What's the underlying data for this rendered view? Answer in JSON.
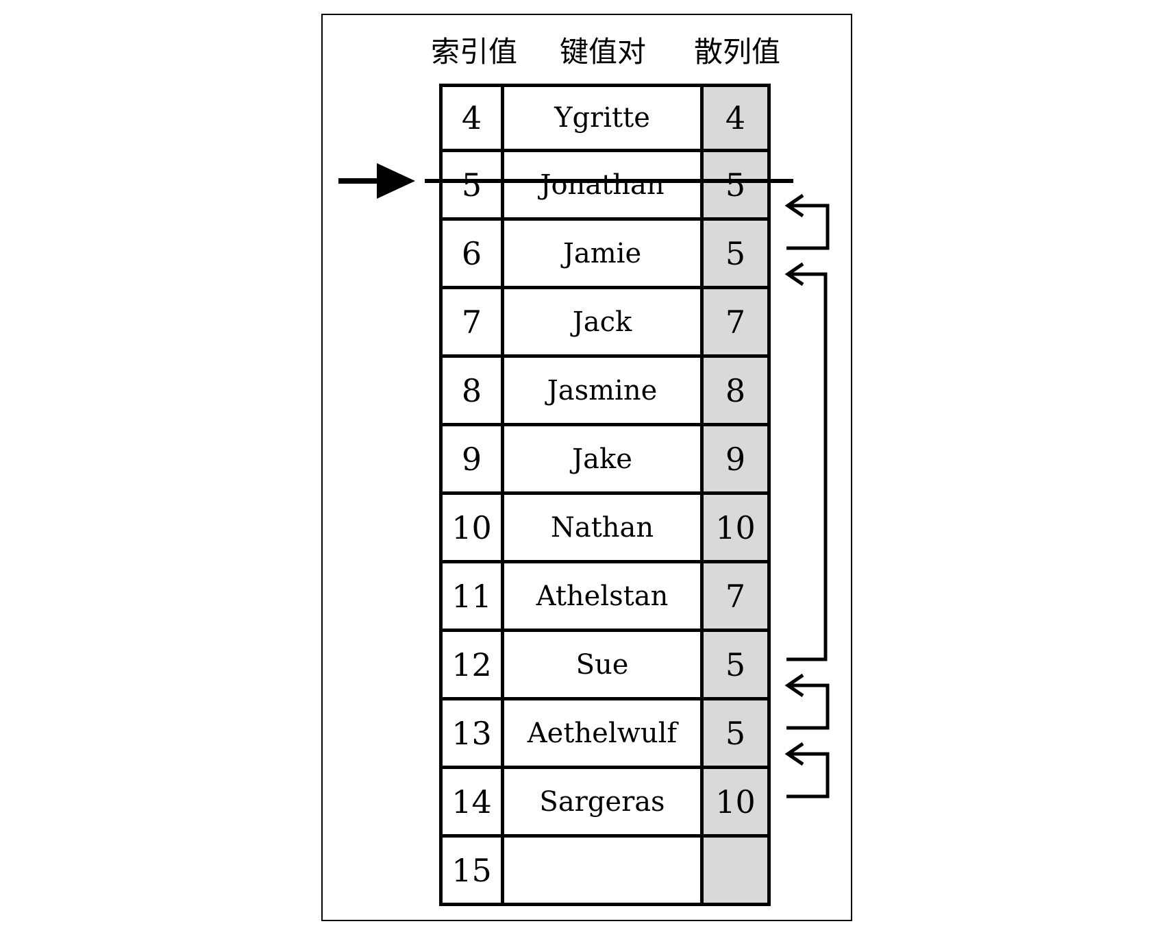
{
  "headers": {
    "index": "索引值",
    "pair": "键值对",
    "hash": "散列值"
  },
  "rows": [
    {
      "index": "4",
      "key": "Ygritte",
      "hash": "4"
    },
    {
      "index": "5",
      "key": "Jonathan",
      "hash": "5"
    },
    {
      "index": "6",
      "key": "Jamie",
      "hash": "5"
    },
    {
      "index": "7",
      "key": "Jack",
      "hash": "7"
    },
    {
      "index": "8",
      "key": "Jasmine",
      "hash": "8"
    },
    {
      "index": "9",
      "key": "Jake",
      "hash": "9"
    },
    {
      "index": "10",
      "key": "Nathan",
      "hash": "10"
    },
    {
      "index": "11",
      "key": "Athelstan",
      "hash": "7"
    },
    {
      "index": "12",
      "key": "Sue",
      "hash": "5"
    },
    {
      "index": "13",
      "key": "Aethelwulf",
      "hash": "5"
    },
    {
      "index": "14",
      "key": "Sargeras",
      "hash": "10"
    },
    {
      "index": "15",
      "key": "",
      "hash": ""
    }
  ],
  "pointer_row": "5",
  "struck_row": "5",
  "links": [
    {
      "from": "6",
      "to": "5"
    },
    {
      "from": "12",
      "to": "6"
    },
    {
      "from": "13",
      "to": "12"
    },
    {
      "from": "14",
      "to": "13"
    }
  ],
  "colors": {
    "hash_column": "#d9d9d9",
    "lines": "#000000"
  }
}
